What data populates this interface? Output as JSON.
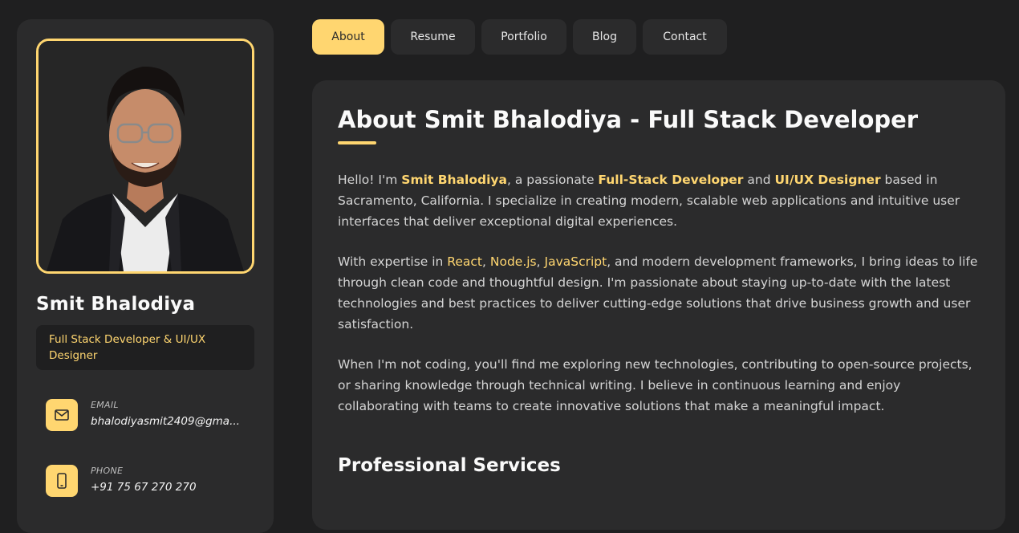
{
  "colors": {
    "accent": "#ffd670",
    "background": "#1f1f20",
    "card": "#2b2b2c"
  },
  "profile": {
    "name": "Smit Bhalodiya",
    "title": "Full Stack Developer & UI/UX Designer",
    "contacts": [
      {
        "icon": "mail-icon",
        "label": "EMAIL",
        "value": "bhalodiyasmit2409@gma..."
      },
      {
        "icon": "phone-icon",
        "label": "PHONE",
        "value": "+91 75 67 270 270"
      }
    ]
  },
  "nav": {
    "tabs": [
      {
        "label": "About",
        "active": true
      },
      {
        "label": "Resume",
        "active": false
      },
      {
        "label": "Portfolio",
        "active": false
      },
      {
        "label": "Blog",
        "active": false
      },
      {
        "label": "Contact",
        "active": false
      }
    ]
  },
  "about": {
    "heading": "About Smit Bhalodiya - Full Stack Developer",
    "p1": {
      "t1": "Hello! I'm ",
      "name": "Smit Bhalodiya",
      "t2": ", a passionate ",
      "role1": "Full-Stack Developer",
      "t3": " and ",
      "role2": "UI/UX Designer",
      "t4": " based in Sacramento, California. I specialize in creating modern, scalable web applications and intuitive user interfaces that deliver exceptional digital experiences."
    },
    "p2": {
      "t1": "With expertise in ",
      "tech1": "React",
      "sep1": ", ",
      "tech2": "Node.js",
      "sep2": ", ",
      "tech3": "JavaScript",
      "t2": ", and modern development frameworks, I bring ideas to life through clean code and thoughtful design. I'm passionate about staying up-to-date with the latest technologies and best practices to deliver cutting-edge solutions that drive business growth and user satisfaction."
    },
    "p3": "When I'm not coding, you'll find me exploring new technologies, contributing to open-source projects, or sharing knowledge through technical writing. I believe in continuous learning and enjoy collaborating with teams to create innovative solutions that make a meaningful impact.",
    "services_heading": "Professional Services"
  }
}
